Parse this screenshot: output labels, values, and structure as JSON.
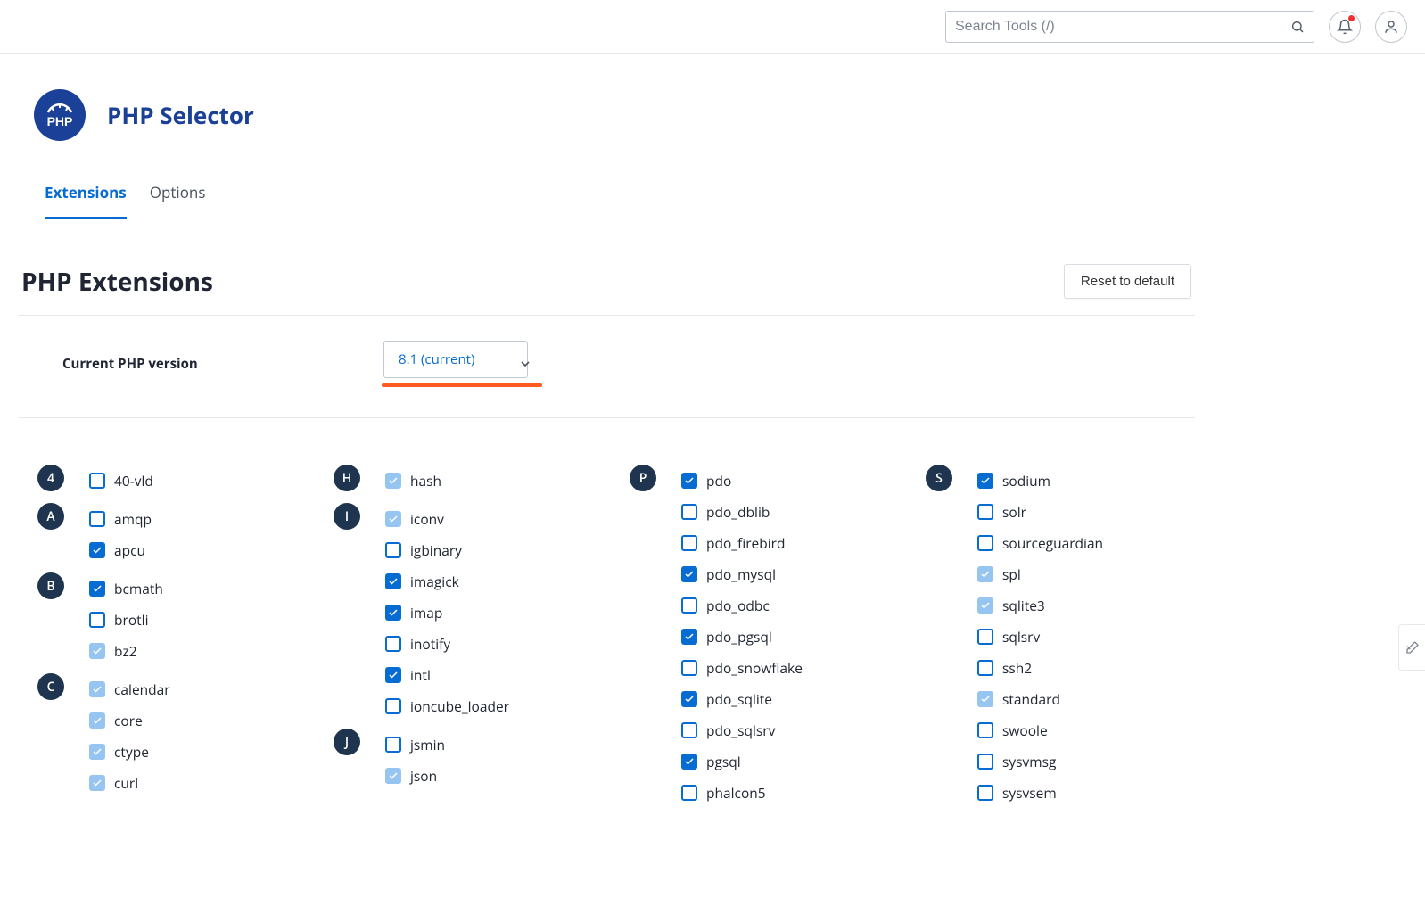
{
  "search": {
    "placeholder": "Search Tools (/)"
  },
  "page": {
    "title": "PHP Selector",
    "tabs": [
      "Extensions",
      "Options"
    ],
    "active_tab": 0,
    "section_title": "PHP Extensions",
    "reset_label": "Reset to default",
    "version_label": "Current PHP version",
    "version_value": "8.1 (current)"
  },
  "columns": [
    [
      {
        "letter": "4",
        "items": [
          {
            "name": "40-vld",
            "state": "unchecked"
          }
        ]
      },
      {
        "letter": "A",
        "items": [
          {
            "name": "amqp",
            "state": "unchecked"
          },
          {
            "name": "apcu",
            "state": "checked"
          }
        ]
      },
      {
        "letter": "B",
        "items": [
          {
            "name": "bcmath",
            "state": "checked"
          },
          {
            "name": "brotli",
            "state": "unchecked"
          },
          {
            "name": "bz2",
            "state": "locked"
          }
        ]
      },
      {
        "letter": "C",
        "items": [
          {
            "name": "calendar",
            "state": "locked"
          },
          {
            "name": "core",
            "state": "locked"
          },
          {
            "name": "ctype",
            "state": "locked"
          },
          {
            "name": "curl",
            "state": "locked"
          }
        ]
      }
    ],
    [
      {
        "letter": "H",
        "items": [
          {
            "name": "hash",
            "state": "locked"
          }
        ]
      },
      {
        "letter": "I",
        "items": [
          {
            "name": "iconv",
            "state": "locked"
          },
          {
            "name": "igbinary",
            "state": "unchecked"
          },
          {
            "name": "imagick",
            "state": "checked"
          },
          {
            "name": "imap",
            "state": "checked"
          },
          {
            "name": "inotify",
            "state": "unchecked"
          },
          {
            "name": "intl",
            "state": "checked"
          },
          {
            "name": "ioncube_loader",
            "state": "unchecked"
          }
        ]
      },
      {
        "letter": "J",
        "items": [
          {
            "name": "jsmin",
            "state": "unchecked"
          },
          {
            "name": "json",
            "state": "locked"
          }
        ]
      }
    ],
    [
      {
        "letter": "P",
        "items": [
          {
            "name": "pdo",
            "state": "checked"
          },
          {
            "name": "pdo_dblib",
            "state": "unchecked"
          },
          {
            "name": "pdo_firebird",
            "state": "unchecked"
          },
          {
            "name": "pdo_mysql",
            "state": "checked"
          },
          {
            "name": "pdo_odbc",
            "state": "unchecked"
          },
          {
            "name": "pdo_pgsql",
            "state": "checked"
          },
          {
            "name": "pdo_snowflake",
            "state": "unchecked"
          },
          {
            "name": "pdo_sqlite",
            "state": "checked"
          },
          {
            "name": "pdo_sqlsrv",
            "state": "unchecked"
          },
          {
            "name": "pgsql",
            "state": "checked"
          },
          {
            "name": "phalcon5",
            "state": "unchecked"
          }
        ]
      }
    ],
    [
      {
        "letter": "S",
        "items": [
          {
            "name": "sodium",
            "state": "checked"
          },
          {
            "name": "solr",
            "state": "unchecked"
          },
          {
            "name": "sourceguardian",
            "state": "unchecked"
          },
          {
            "name": "spl",
            "state": "locked"
          },
          {
            "name": "sqlite3",
            "state": "locked"
          },
          {
            "name": "sqlsrv",
            "state": "unchecked"
          },
          {
            "name": "ssh2",
            "state": "unchecked"
          },
          {
            "name": "standard",
            "state": "locked"
          },
          {
            "name": "swoole",
            "state": "unchecked"
          },
          {
            "name": "sysvmsg",
            "state": "unchecked"
          },
          {
            "name": "sysvsem",
            "state": "unchecked"
          }
        ]
      }
    ]
  ]
}
